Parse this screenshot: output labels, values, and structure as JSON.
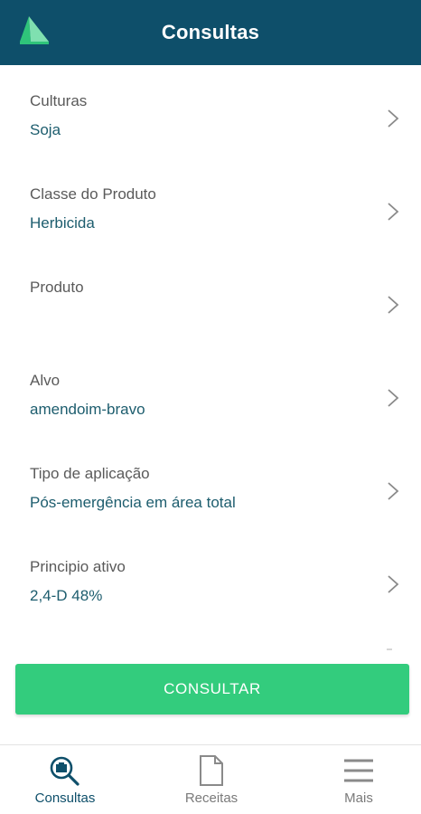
{
  "header": {
    "title": "Consultas",
    "logo_icon": "leaf-logo-icon"
  },
  "fields": [
    {
      "label": "Culturas",
      "value": "Soja"
    },
    {
      "label": "Classe do Produto",
      "value": "Herbicida"
    },
    {
      "label": "Produto",
      "value": ""
    },
    {
      "label": "Alvo",
      "value": "amendoim-bravo"
    },
    {
      "label": "Tipo de aplicação",
      "value": "Pós-emergência em área total"
    },
    {
      "label": "Principio ativo",
      "value": "2,4-D 48%"
    }
  ],
  "button": {
    "label": "CONSULTAR",
    "color": "#33cc7d"
  },
  "bottom_nav": [
    {
      "label": "Consultas",
      "icon": "search-doc-icon",
      "active": true
    },
    {
      "label": "Receitas",
      "icon": "document-icon",
      "active": false
    },
    {
      "label": "Mais",
      "icon": "menu-icon",
      "active": false
    }
  ],
  "colors": {
    "header": "#0e4f6a",
    "value_text": "#1d5d6e",
    "accent": "#33cc7d"
  }
}
